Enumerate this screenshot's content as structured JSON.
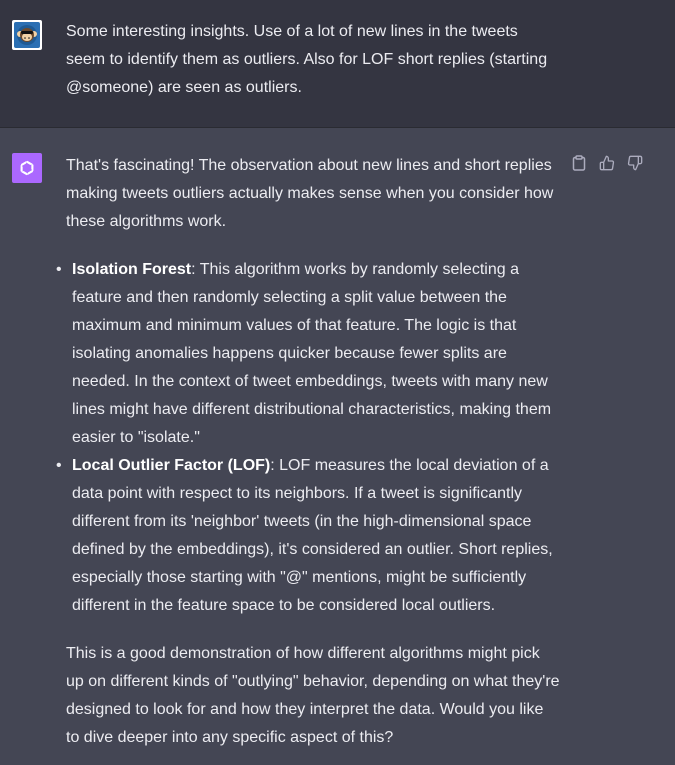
{
  "user_message": {
    "avatar": "monkey-avatar-icon",
    "text": "Some interesting insights. Use of a lot of new lines in the tweets seem to identify them as outliers. Also for LOF short replies (starting @someone) are seen as outliers."
  },
  "assistant_message": {
    "avatar": "openai-logo-icon",
    "intro": "That's fascinating! The observation about new lines and short replies making tweets outliers actually makes sense when you consider how these algorithms work.",
    "points": [
      {
        "title": "Isolation Forest",
        "body": ": This algorithm works by randomly selecting a feature and then randomly selecting a split value between the maximum and minimum values of that feature. The logic is that isolating anomalies happens quicker because fewer splits are needed. In the context of tweet embeddings, tweets with many new lines might have different distributional characteristics, making them easier to \"isolate.\""
      },
      {
        "title": "Local Outlier Factor (LOF)",
        "body": ": LOF measures the local deviation of a data point with respect to its neighbors. If a tweet is significantly different from its 'neighbor' tweets (in the high-dimensional space defined by the embeddings), it's considered an outlier. Short replies, especially those starting with \"@\" mentions, might be sufficiently different in the feature space to be considered local outliers."
      }
    ],
    "conclusion": "This is a good demonstration of how different algorithms might pick up on different kinds of \"outlying\" behavior, depending on what they're designed to look for and how they interpret the data. Would you like to dive deeper into any specific aspect of this?",
    "actions": [
      "clipboard-icon",
      "thumbs-up-icon",
      "thumbs-down-icon"
    ]
  },
  "colors": {
    "user_bg": "#343541",
    "assistant_bg": "#444654",
    "text": "#ececf1",
    "gpt_avatar": "#ab68ff"
  }
}
